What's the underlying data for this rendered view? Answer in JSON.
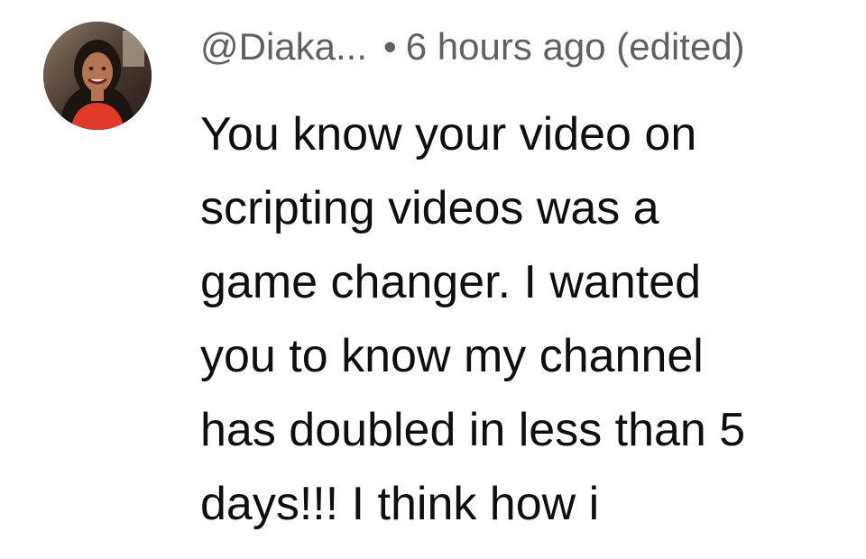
{
  "comment": {
    "avatar_icon": "user-avatar-photo",
    "author": "@Diaka...",
    "separator": "•",
    "timestamp": "6 hours ago (edited)",
    "text_lines": [
      "You know your video on",
      "scripting videos was a",
      "game changer. I wanted",
      "you to know my channel",
      "has doubled in less than 5",
      "days!!! I think how i"
    ]
  },
  "colors": {
    "meta_text": "#606060",
    "body_text": "#0f0f0f",
    "background": "#ffffff"
  }
}
